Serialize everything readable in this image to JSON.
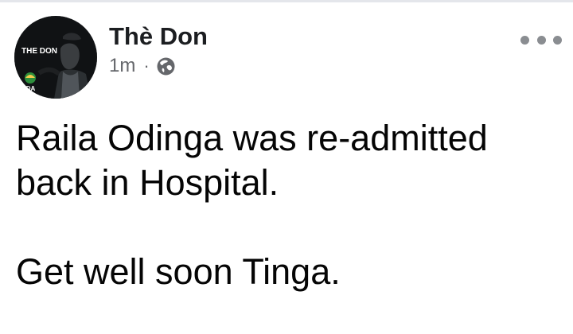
{
  "post": {
    "author": {
      "name": "Thè Don",
      "avatar": {
        "overlay_text": "THE DON",
        "party_text": "UDA"
      }
    },
    "meta": {
      "timestamp": "1m",
      "separator": "·",
      "privacy_icon": "globe-icon"
    },
    "more_options_icon": "more-horizontal-icon",
    "body": {
      "line_1": "Raila Odinga was re-admitted",
      "line_2": "back in Hospital.",
      "line_3": "Get well soon Tinga."
    }
  },
  "colors": {
    "author_name": "#1c1e21",
    "meta_text": "#65676b",
    "body_text": "#050505",
    "more_dots": "#8a8d91",
    "uda_green": "#2d8f3c",
    "uda_yellow": "#f2c94c"
  }
}
